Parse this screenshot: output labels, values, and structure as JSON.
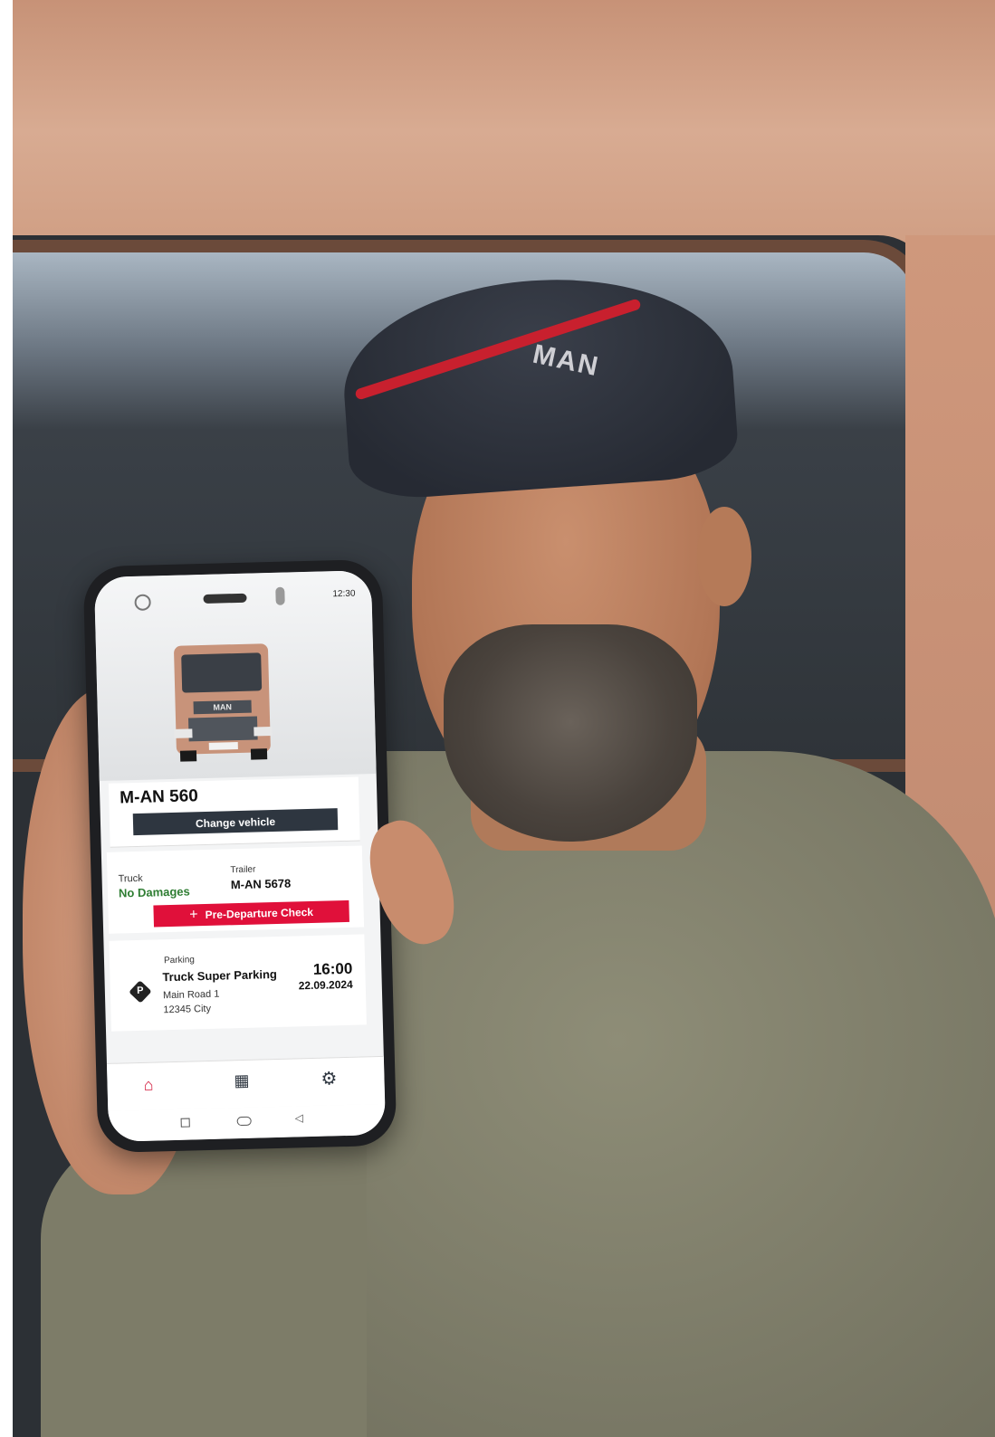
{
  "phone": {
    "status_time": "12:30",
    "vehicle": {
      "plate": "M-AN 560",
      "change_button": "Change vehicle"
    },
    "checks": {
      "truck_label": "Truck",
      "truck_status": "No Damages",
      "trailer_label": "Trailer",
      "trailer_value": "M-AN 5678",
      "pre_departure_button": "Pre-Departure Check"
    },
    "parking": {
      "label": "Parking",
      "icon_letter": "P",
      "name": "Truck Super Parking",
      "street": "Main Road 1",
      "city": "12345 City",
      "time": "16:00",
      "date": "22.09.2024"
    },
    "nav": {
      "home_icon": "home-icon",
      "apps_icon": "grid-icon",
      "settings_icon": "gear-icon"
    }
  },
  "cap_logo": "MAN",
  "truck_logo": "MAN",
  "colors": {
    "accent_red": "#e0103a",
    "dark_button": "#2e3640",
    "ok_green": "#2e7d32"
  }
}
